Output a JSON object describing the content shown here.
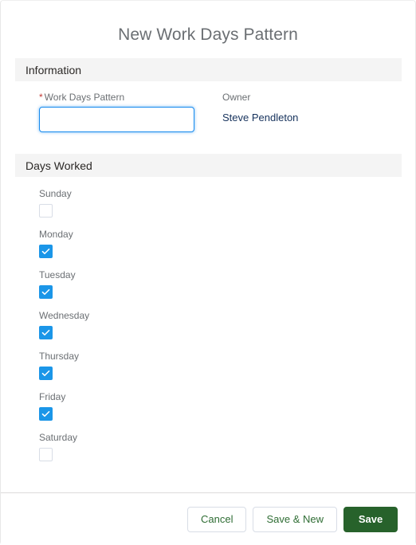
{
  "modal": {
    "title": "New Work Days Pattern"
  },
  "sections": {
    "information": {
      "title": "Information",
      "fields": {
        "work_days_pattern": {
          "label": "Work Days Pattern",
          "required_marker": "*",
          "value": "",
          "placeholder": ""
        },
        "owner": {
          "label": "Owner",
          "value": "Steve Pendleton"
        }
      }
    },
    "days_worked": {
      "title": "Days Worked",
      "days": [
        {
          "label": "Sunday",
          "checked": false
        },
        {
          "label": "Monday",
          "checked": true
        },
        {
          "label": "Tuesday",
          "checked": true
        },
        {
          "label": "Wednesday",
          "checked": true
        },
        {
          "label": "Thursday",
          "checked": true
        },
        {
          "label": "Friday",
          "checked": true
        },
        {
          "label": "Saturday",
          "checked": false
        }
      ]
    }
  },
  "footer": {
    "cancel_label": "Cancel",
    "save_new_label": "Save & New",
    "save_label": "Save"
  },
  "colors": {
    "accent_blue": "#1b96e8",
    "focus_blue": "#1589ee",
    "brand_green": "#27622b",
    "link_green": "#2f6d34",
    "required_red": "#c23934",
    "band_gray": "#f4f4f4",
    "label_gray": "#6b6f73"
  }
}
